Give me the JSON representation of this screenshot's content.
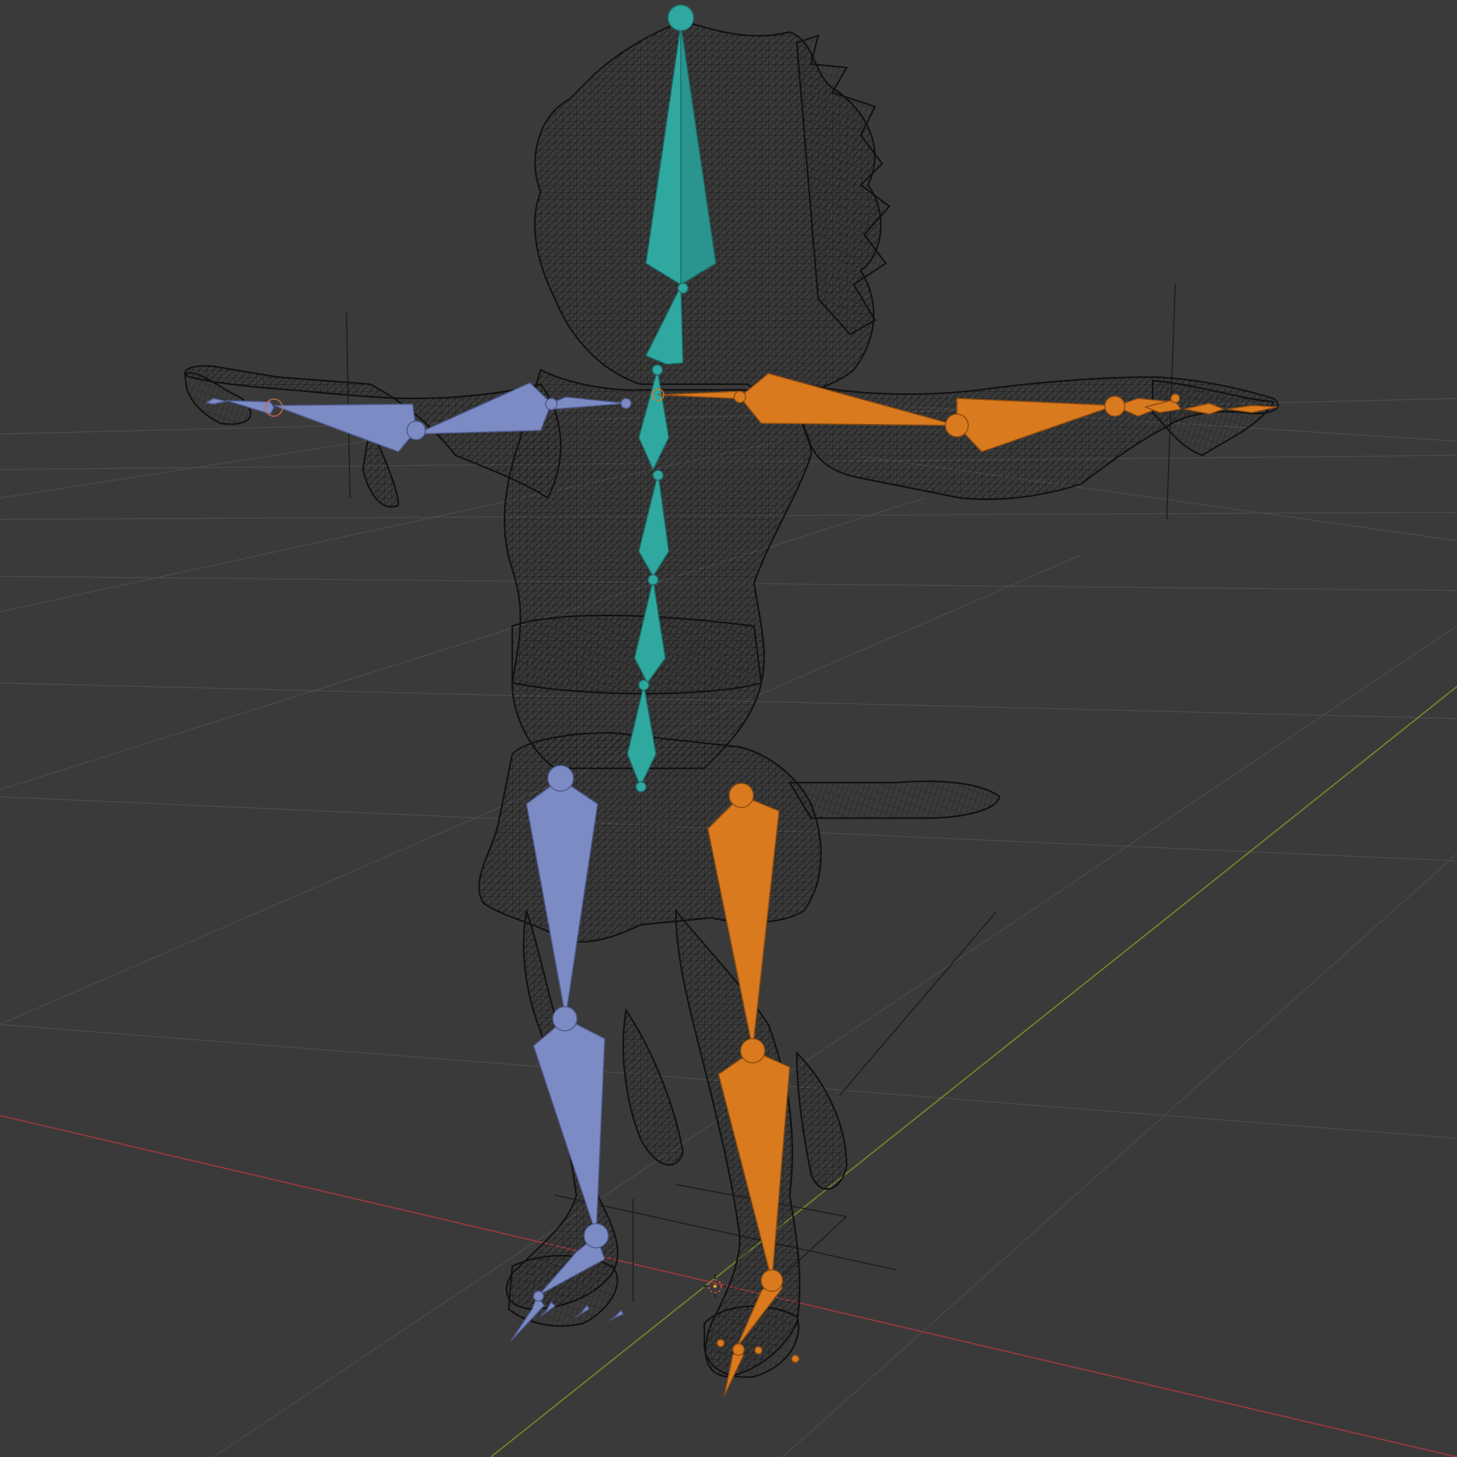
{
  "viewport": {
    "background": "#3a3a3a",
    "grid_color": "#4a4a4a",
    "x_axis_color": "#9a3a3e",
    "y_axis_color": "#6f8a2a"
  },
  "mesh": {
    "wire_color": "#111111"
  },
  "bone_colors": {
    "center": "#2fa8a0",
    "left": "#7d8bc4",
    "right": "#d97a1e"
  },
  "icons": {
    "origin": "3d-cursor-icon"
  }
}
